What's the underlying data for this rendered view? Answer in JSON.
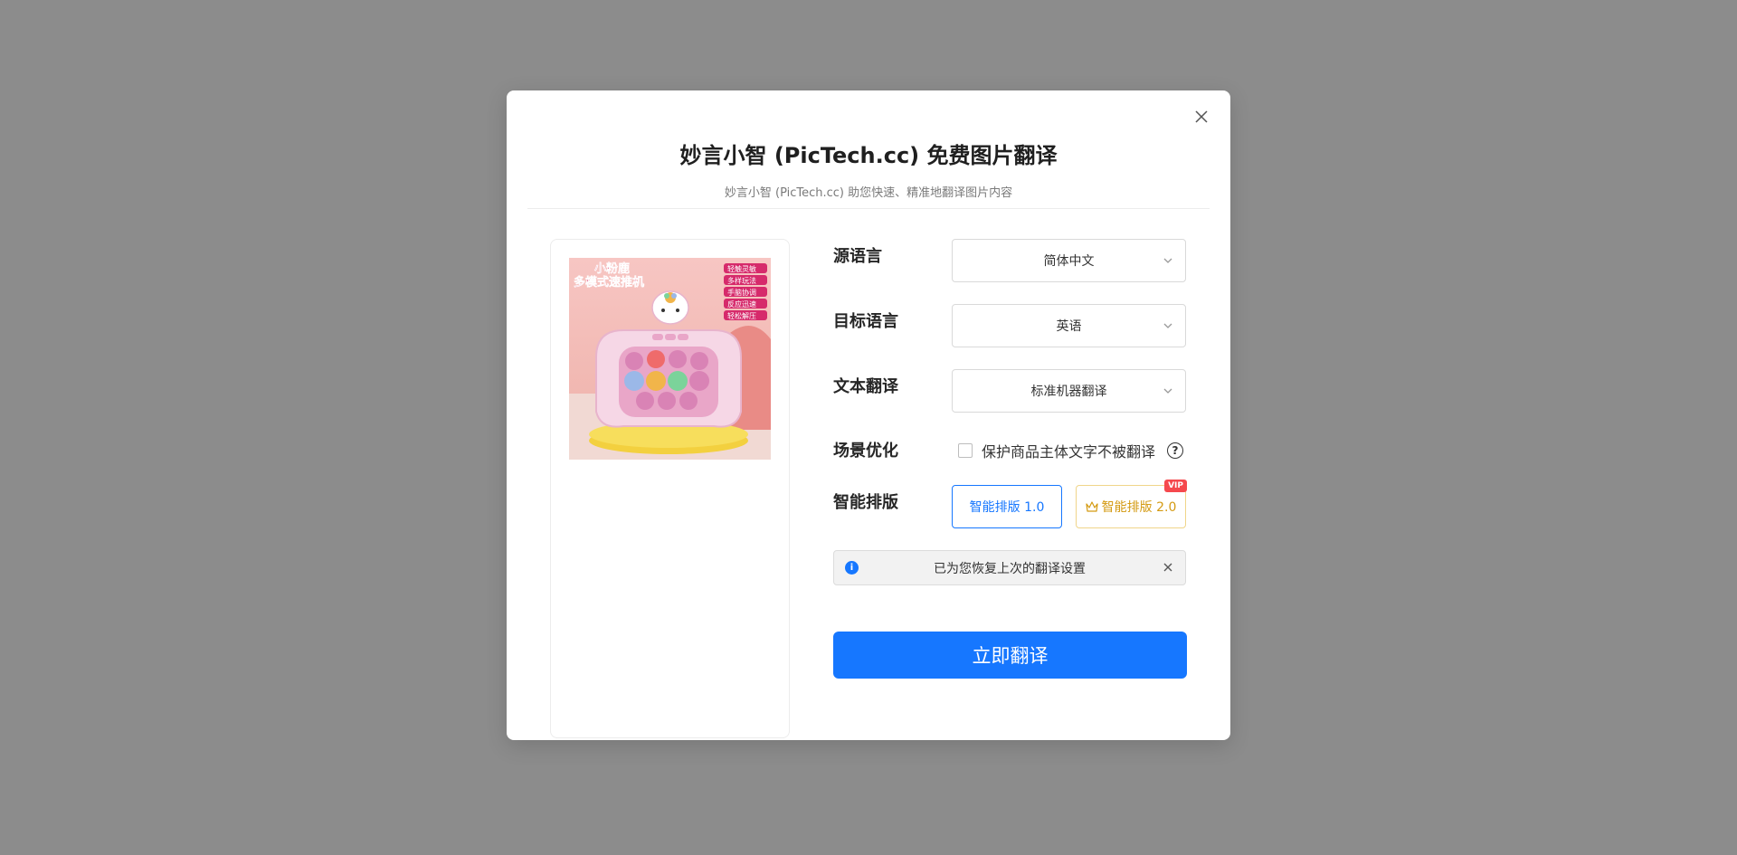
{
  "modal": {
    "title": "妙言小智 (PicTech.cc) 免费图片翻译",
    "subtitle": "妙言小智 (PicTech.cc) 助您快速、精准地翻译图片内容",
    "close_icon": "close-icon"
  },
  "preview": {
    "image_texts": {
      "heading_line1": "小粉鹿",
      "heading_line2": "多模式速推机",
      "tags": [
        "轻触灵敏",
        "多样玩法",
        "手脑协调",
        "反应迅速",
        "轻松解压"
      ]
    }
  },
  "form": {
    "source_language": {
      "label": "源语言",
      "value": "简体中文"
    },
    "target_language": {
      "label": "目标语言",
      "value": "英语"
    },
    "text_translation": {
      "label": "文本翻译",
      "value": "标准机器翻译"
    },
    "scene_optimization": {
      "label": "场景优化",
      "checkbox_label": "保护商品主体文字不被翻译",
      "checked": false,
      "help_icon": "?"
    },
    "smart_layout": {
      "label": "智能排版",
      "option1": "智能排版 1.0",
      "option2": "智能排版 2.0",
      "vip_badge": "VIP",
      "selected": "智能排版 1.0"
    }
  },
  "notice": {
    "text": "已为您恢复上次的翻译设置",
    "info_icon": "i"
  },
  "actions": {
    "translate_label": "立即翻译"
  },
  "colors": {
    "accent": "#1677ff",
    "overlay": "#8c8c8c",
    "vip": "#f5484d",
    "gold": "#d49a12"
  }
}
